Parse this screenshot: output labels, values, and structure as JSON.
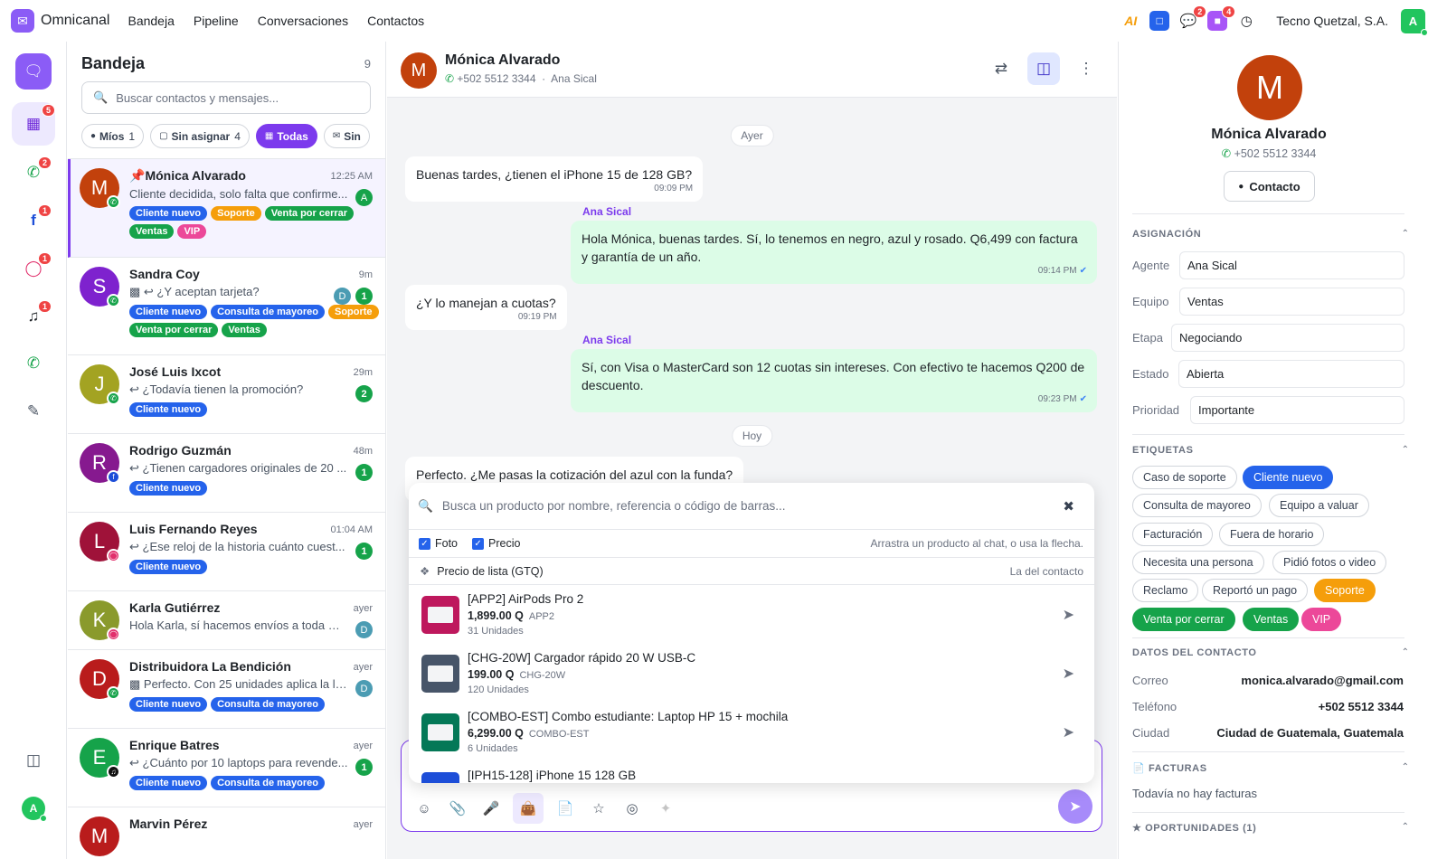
{
  "app": {
    "name": "Omnicanal"
  },
  "topnav": [
    "Bandeja",
    "Pipeline",
    "Conversaciones",
    "Contactos"
  ],
  "topbar": {
    "ai_label": "AI",
    "chat_badge": "2",
    "app_badge": "4",
    "company": "Tecno Quetzal, S.A.",
    "avatar": "A"
  },
  "rail": {
    "items": [
      {
        "icon": "chat-icon",
        "badge": ""
      },
      {
        "icon": "grid-icon",
        "badge": "5"
      },
      {
        "icon": "whatsapp-icon",
        "badge": "2"
      },
      {
        "icon": "facebook-icon",
        "badge": "1"
      },
      {
        "icon": "instagram-icon",
        "badge": "1"
      },
      {
        "icon": "tiktok-icon",
        "badge": "1"
      },
      {
        "icon": "whatsapp-icon",
        "badge": ""
      },
      {
        "icon": "compose-icon",
        "badge": ""
      }
    ],
    "avatar": "A"
  },
  "inbox": {
    "title": "Bandeja",
    "count": "9",
    "search_placeholder": "Buscar contactos y mensajes...",
    "filters": [
      {
        "label": "Míos",
        "count": "1"
      },
      {
        "label": "Sin asignar",
        "count": "4"
      },
      {
        "label": "Todas",
        "count": ""
      },
      {
        "label": "Sin",
        "count": ""
      }
    ],
    "conversations": [
      {
        "initial": "M",
        "name": "Mónica Alvarado",
        "time": "12:25 AM",
        "preview": "Cliente decidida, solo falta que confirme...",
        "assignee": "A",
        "count": "",
        "tags": [
          "Cliente nuevo",
          "Soporte",
          "Venta por cerrar",
          "Ventas",
          "VIP"
        ]
      },
      {
        "initial": "S",
        "name": "Sandra Coy",
        "time": "9m",
        "preview": "¿Y aceptan tarjeta?",
        "assignee": "D",
        "count": "1",
        "tags": [
          "Cliente nuevo",
          "Consulta de mayoreo",
          "Soporte",
          "Venta por cerrar",
          "Ventas"
        ]
      },
      {
        "initial": "J",
        "name": "José Luis Ixcot",
        "time": "29m",
        "preview": "¿Todavía tienen la promoción?",
        "assignee": "",
        "count": "2",
        "tags": [
          "Cliente nuevo"
        ]
      },
      {
        "initial": "R",
        "name": "Rodrigo Guzmán",
        "time": "48m",
        "preview": "¿Tienen cargadores originales de 20 ...",
        "assignee": "",
        "count": "1",
        "tags": [
          "Cliente nuevo"
        ]
      },
      {
        "initial": "L",
        "name": "Luis Fernando Reyes",
        "time": "01:04 AM",
        "preview": "¿Ese reloj de la historia cuánto cuest...",
        "assignee": "",
        "count": "1",
        "tags": [
          "Cliente nuevo"
        ]
      },
      {
        "initial": "K",
        "name": "Karla Gutiérrez",
        "time": "ayer",
        "preview": "Hola Karla, sí hacemos envíos a toda Gu...",
        "assignee": "D",
        "count": "",
        "tags": []
      },
      {
        "initial": "D",
        "name": "Distribuidora La Bendición",
        "time": "ayer",
        "preview": "Perfecto. Con 25 unidades aplica la lis...",
        "assignee": "D",
        "count": "",
        "tags": [
          "Cliente nuevo",
          "Consulta de mayoreo"
        ]
      },
      {
        "initial": "E",
        "name": "Enrique Batres",
        "time": "ayer",
        "preview": "¿Cuánto por 10 laptops para revende...",
        "assignee": "",
        "count": "1",
        "tags": [
          "Cliente nuevo",
          "Consulta de mayoreo"
        ]
      },
      {
        "initial": "M",
        "name": "Marvin Pérez",
        "time": "ayer",
        "preview": "",
        "assignee": "",
        "count": "",
        "tags": []
      }
    ]
  },
  "chat": {
    "contact_initial": "M",
    "contact_name": "Mónica Alvarado",
    "contact_phone": "+502 5512 3344",
    "agent": "Ana Sical",
    "date_yesterday": "Ayer",
    "date_today": "Hoy",
    "messages": [
      {
        "text": "Buenas tardes, ¿tienen el iPhone 15 de 128 GB?",
        "time": "09:09 PM"
      },
      {
        "sender": "Ana Sical",
        "text": "Hola Mónica, buenas tardes. Sí, lo tenemos en negro, azul y rosado. Q6,499 con factura y garantía de un año.",
        "time": "09:14 PM"
      },
      {
        "text": "¿Y lo manejan a cuotas?",
        "time": "09:19 PM"
      },
      {
        "sender": "Ana Sical",
        "text": "Sí, con Visa o MasterCard son 12 cuotas sin intereses. Con efectivo te hacemos Q200 de descuento.",
        "time": "09:23 PM"
      },
      {
        "text": "Perfecto. ¿Me pasas la cotización del azul con la funda?",
        "time": ""
      }
    ]
  },
  "picker": {
    "search_placeholder": "Busca un producto por nombre, referencia o código de barras...",
    "opt_photo": "Foto",
    "opt_price": "Precio",
    "hint": "Arrastra un producto al chat, o usa la flecha.",
    "price_list": "Precio de lista (GTQ)",
    "price_list_right": "La del contacto",
    "products": [
      {
        "title": "[APP2] AirPods Pro 2",
        "price": "1,899.00 Q",
        "sku": "APP2",
        "stock": "31 Unidades",
        "color": "#be185d"
      },
      {
        "title": "[CHG-20W] Cargador rápido 20 W USB-C",
        "price": "199.00 Q",
        "sku": "CHG-20W",
        "stock": "120 Unidades",
        "color": "#475569"
      },
      {
        "title": "[COMBO-EST] Combo estudiante: Laptop HP 15 + mochila",
        "price": "6,299.00 Q",
        "sku": "COMBO-EST",
        "stock": "6 Unidades",
        "color": "#047857"
      },
      {
        "title": "[IPH15-128] iPhone 15 128 GB",
        "price": "",
        "sku": "",
        "stock": "",
        "color": "#1d4ed8"
      }
    ]
  },
  "panel": {
    "initial": "M",
    "name": "Mónica Alvarado",
    "phone": "+502 5512 3344",
    "contact_button": "Contacto",
    "sec_assign": "ASIGNACIÓN",
    "fields": [
      {
        "label": "Agente",
        "value": "Ana Sical"
      },
      {
        "label": "Equipo",
        "value": "Ventas"
      },
      {
        "label": "Etapa",
        "value": "Negociando"
      },
      {
        "label": "Estado",
        "value": "Abierta"
      },
      {
        "label": "Prioridad",
        "value": "Importante"
      }
    ],
    "sec_tags": "ETIQUETAS",
    "tags": [
      "Caso de soporte",
      "Cliente nuevo",
      "Consulta de mayoreo",
      "Equipo a valuar",
      "Facturación",
      "Fuera de horario",
      "Necesita una persona",
      "Pidió fotos o video",
      "Reclamo",
      "Reportó un pago",
      "Soporte",
      "Venta por cerrar",
      "Ventas",
      "VIP"
    ],
    "sec_contact": "DATOS DEL CONTACTO",
    "contact": [
      {
        "label": "Correo",
        "value": "monica.alvarado@gmail.com"
      },
      {
        "label": "Teléfono",
        "value": "+502 5512 3344"
      },
      {
        "label": "Ciudad",
        "value": "Ciudad de Guatemala, Guatemala"
      }
    ],
    "sec_invoices": "FACTURAS",
    "invoices_empty": "Todavía no hay facturas",
    "sec_opps": "OPORTUNIDADES (1)"
  },
  "colors": {
    "accent": "#7c3aed",
    "whatsapp": "#16a34a",
    "bubble_out": "#dcfce7"
  }
}
